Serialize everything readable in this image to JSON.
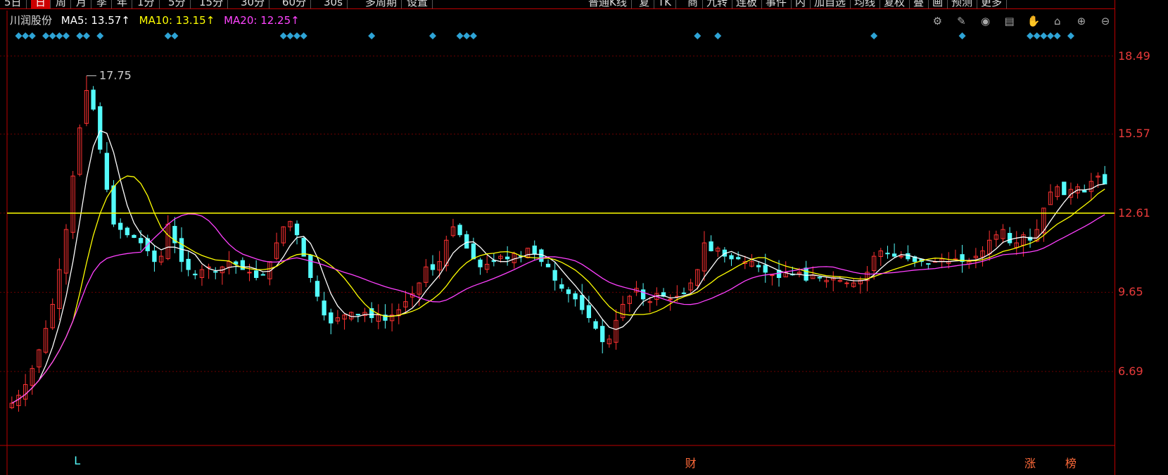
{
  "toolbar": {
    "items": [
      {
        "label": "5日",
        "active": false
      },
      {
        "label": "日",
        "active": true
      },
      {
        "label": "周",
        "active": false
      },
      {
        "label": "月",
        "active": false
      },
      {
        "label": "季",
        "active": false
      },
      {
        "label": "年",
        "active": false
      },
      {
        "label": "1分",
        "active": false
      },
      {
        "label": "5分",
        "active": false
      },
      {
        "label": "15分",
        "active": false
      },
      {
        "label": "30分",
        "active": false
      },
      {
        "label": "60分",
        "active": false
      },
      {
        "label": "30s",
        "active": false
      },
      {
        "label": "多周期",
        "active": false
      },
      {
        "label": "设置",
        "active": false
      }
    ],
    "right_items": [
      "普通K线",
      "复",
      "TK",
      "商",
      "九转",
      "连板",
      "事件",
      "内",
      "加自选",
      "均线",
      "复权",
      "叠",
      "画",
      "预测",
      "更多"
    ]
  },
  "stock": {
    "name": "川润股份",
    "ma5": "MA5: 13.57↑",
    "ma10": "MA10: 13.15↑",
    "ma20": "MA20: 12.25↑"
  },
  "colors": {
    "up": "#ff3232",
    "down": "#54fcfc",
    "ma5": "#ffffff",
    "ma10": "#ffff00",
    "ma20": "#ff40ff",
    "hline": "#ffff00",
    "grid": "#6a0000",
    "axis_text": "#e83a3a",
    "event_marker": "#2ea4d6"
  },
  "tools": [
    "gear-icon",
    "pen-icon",
    "eye-icon",
    "box-icon",
    "hand-icon",
    "lock-icon",
    "zoom-in-icon",
    "zoom-out-icon"
  ],
  "chart_data": {
    "type": "candlestick",
    "y_ticks": [
      "18.49",
      "15.57",
      "12.61",
      "9.65",
      "6.69"
    ],
    "y_tick_values": [
      18.49,
      15.57,
      12.61,
      9.65,
      6.69
    ],
    "ylim": [
      4.0,
      19.4
    ],
    "horizontal_line": 12.61,
    "high_annotation": "17.75",
    "high_value": 17.75,
    "x_count": 160,
    "bottom_markers": [
      {
        "label": "L",
        "index": 10,
        "color": "#54fcfc"
      },
      {
        "label": "财",
        "index": 100,
        "color": "#ff6a3a"
      },
      {
        "label": "涨",
        "index": 150,
        "color": "#ff6a3a"
      },
      {
        "label": "榜",
        "index": 156,
        "color": "#ff6a3a"
      }
    ],
    "event_indices": [
      1,
      2,
      3,
      5,
      6,
      7,
      8,
      10,
      11,
      13,
      23,
      24,
      40,
      41,
      42,
      43,
      53,
      62,
      66,
      67,
      68,
      101,
      104,
      127,
      140,
      150,
      151,
      152,
      153,
      154,
      156
    ],
    "close_path": [
      5.5,
      5.8,
      6.2,
      6.8,
      7.5,
      8.3,
      9.2,
      10.5,
      12.0,
      14.0,
      15.8,
      17.2,
      16.5,
      15.0,
      13.5,
      12.2,
      12.0,
      11.8,
      11.7,
      11.5,
      11.2,
      10.8,
      11.0,
      12.2,
      11.5,
      10.8,
      10.5,
      10.3,
      10.5,
      10.6,
      10.4,
      10.6,
      10.8,
      10.7,
      10.5,
      10.4,
      10.2,
      10.3,
      10.8,
      11.5,
      12.1,
      12.3,
      11.8,
      11.0,
      10.2,
      9.5,
      8.8,
      8.5,
      8.7,
      8.8,
      8.9,
      8.8,
      8.9,
      8.7,
      8.8,
      8.6,
      8.8,
      9.0,
      9.3,
      9.6,
      10.0,
      10.6,
      10.5,
      10.8,
      11.6,
      12.1,
      11.8,
      11.3,
      10.9,
      10.6,
      10.7,
      10.8,
      11.0,
      10.9,
      11.1,
      11.0,
      11.3,
      11.1,
      10.8,
      10.6,
      10.1,
      9.8,
      9.6,
      9.4,
      9.0,
      8.7,
      8.3,
      7.8,
      7.9,
      8.6,
      9.2,
      9.5,
      9.8,
      9.4,
      9.3,
      9.6,
      9.5,
      9.4,
      9.5,
      9.6,
      10.0,
      10.5,
      11.5,
      11.2,
      11.3,
      11.0,
      10.9,
      10.9,
      10.8,
      10.8,
      10.6,
      10.4,
      10.3,
      10.2,
      10.4,
      10.3,
      10.4,
      10.1,
      10.3,
      10.2,
      10.1,
      10.2,
      10.1,
      10.0,
      10.0,
      10.1,
      10.4,
      11.0,
      11.2,
      11.1,
      11.0,
      11.0,
      10.9,
      10.8,
      10.8,
      10.7,
      10.8,
      10.9,
      10.8,
      10.9,
      10.8,
      10.8,
      11.0,
      11.2,
      11.6,
      11.8,
      12.0,
      11.5,
      11.5,
      11.8,
      11.6,
      12.0,
      12.8,
      13.4,
      13.6,
      13.3,
      13.5,
      13.6,
      13.4,
      13.8,
      14.0,
      13.7
    ]
  }
}
